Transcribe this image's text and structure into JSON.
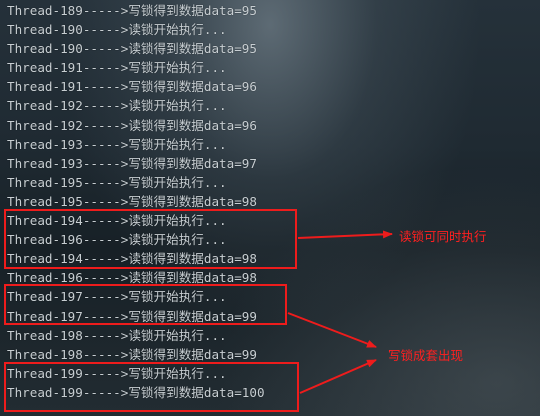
{
  "console": {
    "lines": [
      "Thread-189----->写锁得到数据data=95",
      "Thread-190----->读锁开始执行...",
      "Thread-190----->读锁得到数据data=95",
      "Thread-191----->写锁开始执行...",
      "Thread-191----->写锁得到数据data=96",
      "Thread-192----->读锁开始执行...",
      "Thread-192----->读锁得到数据data=96",
      "Thread-193----->写锁开始执行...",
      "Thread-193----->写锁得到数据data=97",
      "Thread-195----->写锁开始执行...",
      "Thread-195----->写锁得到数据data=98",
      "Thread-194----->读锁开始执行...",
      "Thread-196----->读锁开始执行...",
      "Thread-194----->读锁得到数据data=98",
      "Thread-196----->读锁得到数据data=98",
      "Thread-197----->写锁开始执行...",
      "Thread-197----->写锁得到数据data=99",
      "Thread-198----->读锁开始执行...",
      "Thread-198----->读锁得到数据data=99",
      "Thread-199----->写锁开始执行...",
      "Thread-199----->写锁得到数据data=100"
    ]
  },
  "annotations": {
    "read_note": "读锁可同时执行",
    "write_note": "写锁成套出现",
    "color": "#ee1c1c"
  }
}
